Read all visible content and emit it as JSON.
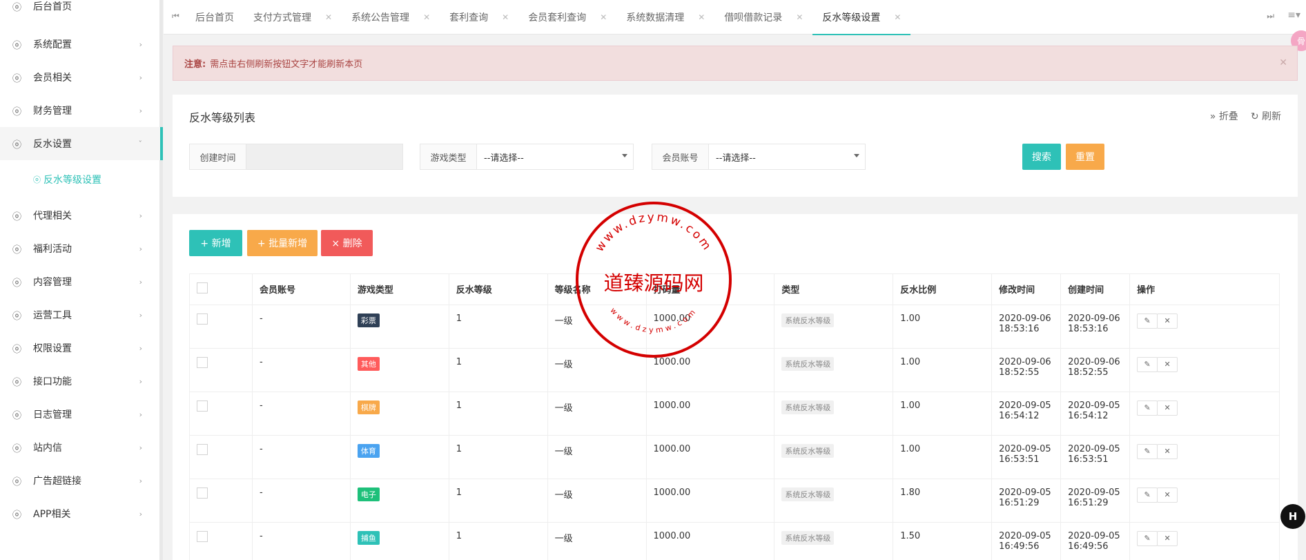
{
  "sidebar": {
    "items": [
      {
        "label": "后台首页",
        "arrow": ""
      },
      {
        "label": "系统配置",
        "arrow": "›"
      },
      {
        "label": "会员相关",
        "arrow": "›"
      },
      {
        "label": "财务管理",
        "arrow": "›"
      },
      {
        "label": "反水设置",
        "arrow": "ˇ"
      },
      {
        "label": "代理相关",
        "arrow": "›"
      },
      {
        "label": "福利活动",
        "arrow": "›"
      },
      {
        "label": "内容管理",
        "arrow": "›"
      },
      {
        "label": "运营工具",
        "arrow": "›"
      },
      {
        "label": "权限设置",
        "arrow": "›"
      },
      {
        "label": "接口功能",
        "arrow": "›"
      },
      {
        "label": "日志管理",
        "arrow": "›"
      },
      {
        "label": "站内信",
        "arrow": "›"
      },
      {
        "label": "广告超链接",
        "arrow": "›"
      },
      {
        "label": "APP相关",
        "arrow": "›"
      }
    ],
    "sub_item": "反水等级设置"
  },
  "tabs": [
    {
      "label": "后台首页",
      "closable": false
    },
    {
      "label": "支付方式管理",
      "closable": true
    },
    {
      "label": "系统公告管理",
      "closable": true
    },
    {
      "label": "套利查询",
      "closable": true
    },
    {
      "label": "会员套利查询",
      "closable": true
    },
    {
      "label": "系统数据清理",
      "closable": true
    },
    {
      "label": "借呗借款记录",
      "closable": true
    },
    {
      "label": "反水等级设置",
      "closable": true
    }
  ],
  "notice": {
    "prefix": "注意:",
    "text": "需点击右侧刷新按钮文字才能刷新本页"
  },
  "search_panel": {
    "title": "反水等级列表",
    "fold_label": "折叠",
    "refresh_label": "刷新",
    "created_time_label": "创建时间",
    "game_type_label": "游戏类型",
    "game_type_value": "--请选择--",
    "member_label": "会员账号",
    "member_value": "--请选择--",
    "search_button": "搜索",
    "reset_button": "重置"
  },
  "table_panel": {
    "add_button": "+ 新增",
    "batch_add_button": "+ 批量新增",
    "delete_button": "× 删除",
    "columns": [
      "会员账号",
      "游戏类型",
      "反水等级",
      "等级名称",
      "打码量",
      "类型",
      "反水比例",
      "修改时间",
      "创建时间",
      "操作"
    ],
    "rows": [
      {
        "member": "-",
        "game": "彩票",
        "game_color": "#2f4056",
        "level": "1",
        "level_name": "一级",
        "amount": "1000.00",
        "type": "系统反水等级",
        "ratio": "1.00",
        "modified": "2020-09-06 18:53:16",
        "created": "2020-09-06 18:53:16"
      },
      {
        "member": "-",
        "game": "其他",
        "game_color": "#ff5b5b",
        "level": "1",
        "level_name": "一级",
        "amount": "1000.00",
        "type": "系统反水等级",
        "ratio": "1.00",
        "modified": "2020-09-06 18:52:55",
        "created": "2020-09-06 18:52:55"
      },
      {
        "member": "-",
        "game": "棋牌",
        "game_color": "#f8a94a",
        "level": "1",
        "level_name": "一级",
        "amount": "1000.00",
        "type": "系统反水等级",
        "ratio": "1.00",
        "modified": "2020-09-05 16:54:12",
        "created": "2020-09-05 16:54:12"
      },
      {
        "member": "-",
        "game": "体育",
        "game_color": "#4aa3f0",
        "level": "1",
        "level_name": "一级",
        "amount": "1000.00",
        "type": "系统反水等级",
        "ratio": "1.00",
        "modified": "2020-09-05 16:53:51",
        "created": "2020-09-05 16:53:51"
      },
      {
        "member": "-",
        "game": "电子",
        "game_color": "#1ec07a",
        "level": "1",
        "level_name": "一级",
        "amount": "1000.00",
        "type": "系统反水等级",
        "ratio": "1.80",
        "modified": "2020-09-05 16:51:29",
        "created": "2020-09-05 16:51:29"
      },
      {
        "member": "-",
        "game": "捕鱼",
        "game_color": "#2ec1b7",
        "level": "1",
        "level_name": "一级",
        "amount": "1000.00",
        "type": "系统反水等级",
        "ratio": "1.50",
        "modified": "2020-09-05 16:49:56",
        "created": "2020-09-05 16:49:56"
      }
    ]
  },
  "watermark": {
    "main_text": "道臻源码网",
    "ring_top": "www.dzymw.com",
    "ring_bottom": "www.dzymw.com"
  },
  "accent_color": "#2ec1b7"
}
